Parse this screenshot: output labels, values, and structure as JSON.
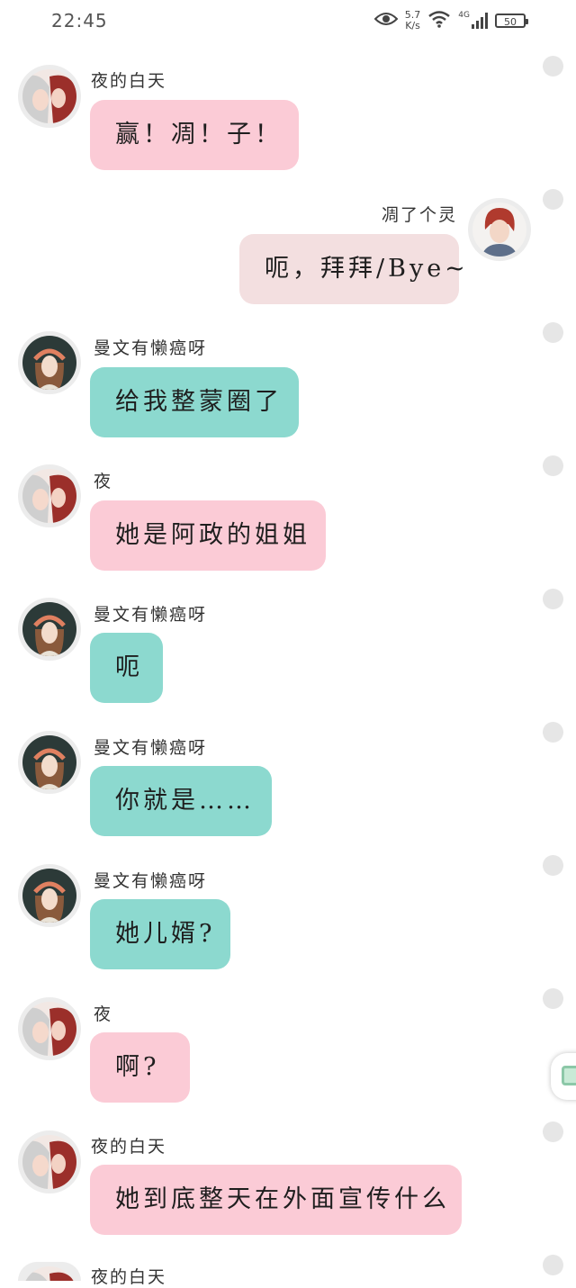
{
  "status": {
    "time": "22:45",
    "speed_value": "5.7",
    "speed_unit": "K/s",
    "network": "4G",
    "battery": "50",
    "icons": [
      "eye-icon",
      "wifi-icon",
      "signal-icon",
      "battery-icon"
    ]
  },
  "messages": [
    {
      "sender": "夜的白天",
      "text": "赢！凋！子！",
      "side": "left",
      "color": "pink"
    },
    {
      "sender": "凋了个灵",
      "text": "呃，拜拜/Bye~",
      "side": "right",
      "color": "blush"
    },
    {
      "sender": "曼文有懒癌呀",
      "text": "给我整蒙圈了",
      "side": "left",
      "color": "teal"
    },
    {
      "sender": "夜",
      "text": "她是阿政的姐姐",
      "side": "left",
      "color": "pink"
    },
    {
      "sender": "曼文有懒癌呀",
      "text": "呃",
      "side": "left",
      "color": "teal"
    },
    {
      "sender": "曼文有懒癌呀",
      "text": "你就是……",
      "side": "left",
      "color": "teal"
    },
    {
      "sender": "曼文有懒癌呀",
      "text": "她儿婿?",
      "side": "left",
      "color": "teal"
    },
    {
      "sender": "夜",
      "text": "啊?",
      "side": "left",
      "color": "pink"
    },
    {
      "sender": "夜的白天",
      "text": "她到底整天在外面宣传什么",
      "side": "left",
      "color": "pink"
    },
    {
      "sender": "夜的白天",
      "text": "",
      "side": "left",
      "color": "pink"
    }
  ],
  "colors": {
    "pink": "#fbcbd6",
    "teal": "#8cd9cf",
    "blush": "#f3dfe0",
    "radio": "#e6e6e6"
  }
}
